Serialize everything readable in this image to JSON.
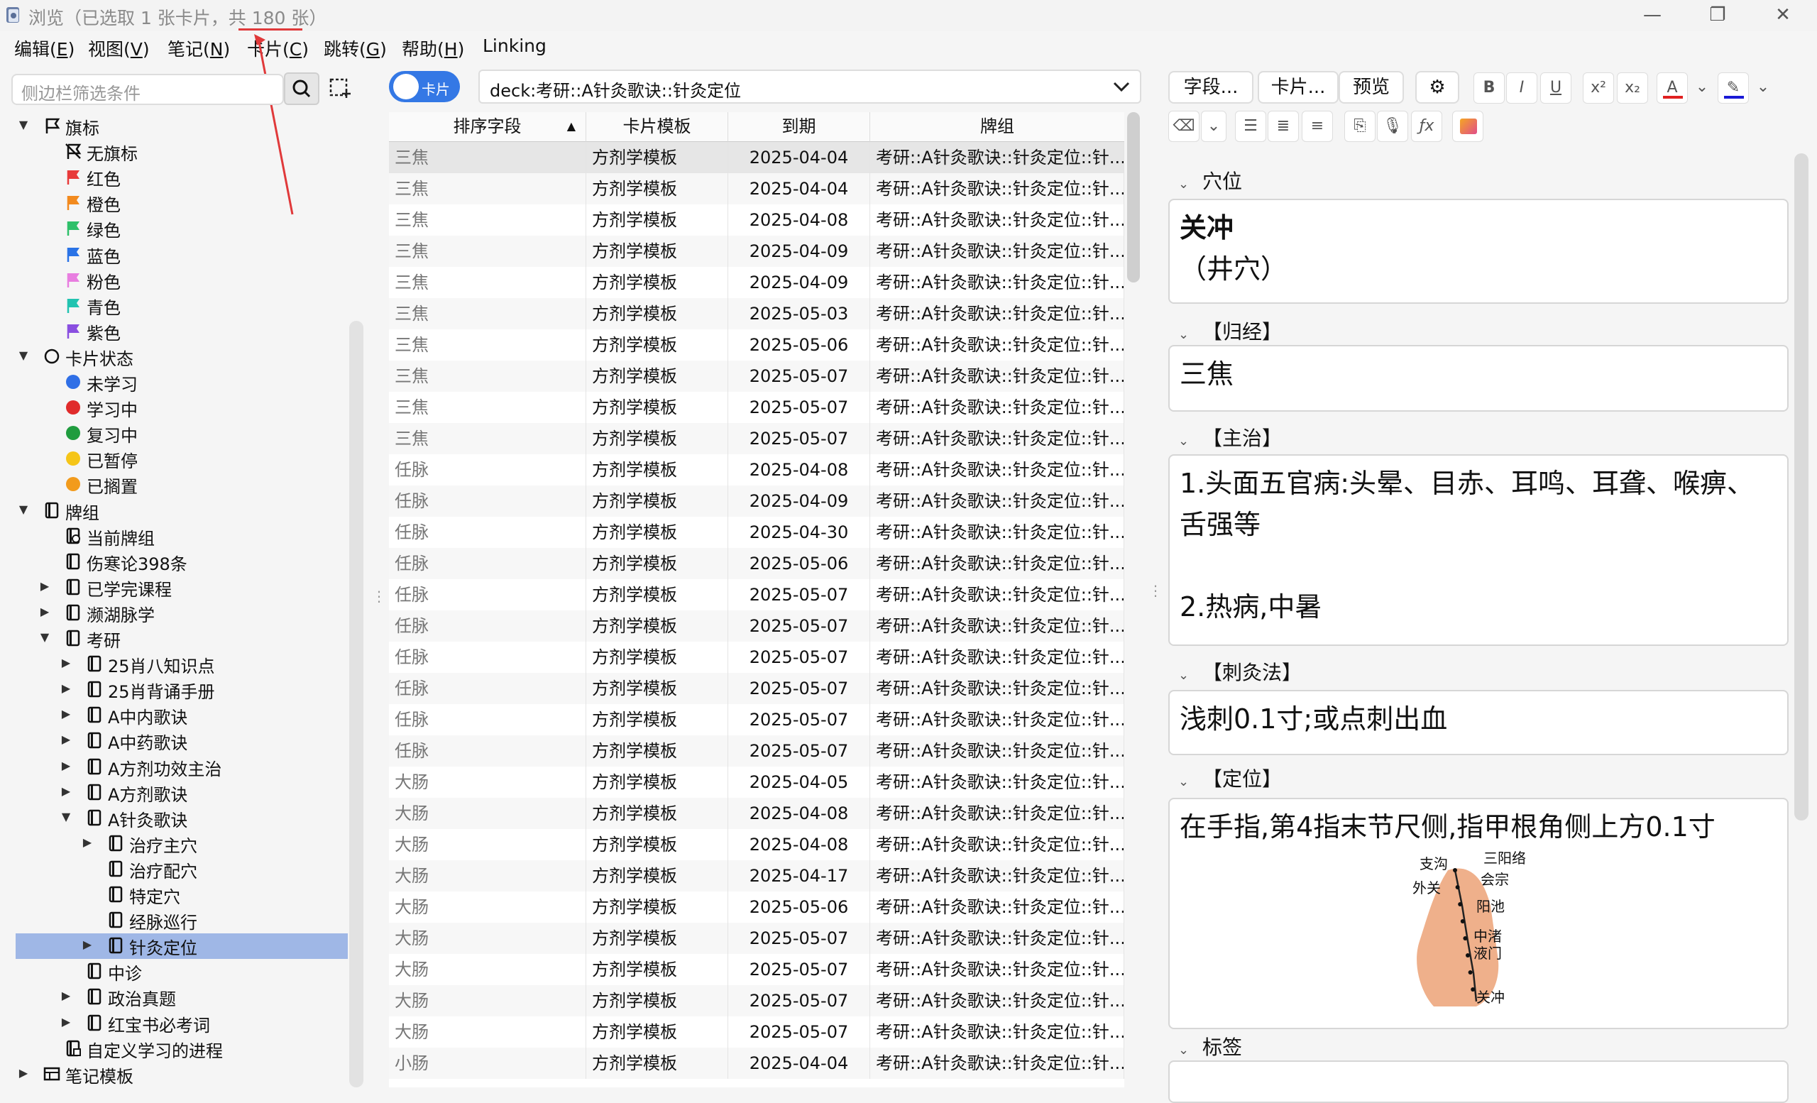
{
  "window": {
    "title": "浏览（已选取 1 张卡片，共 180 张）",
    "minimize_icon": "minimize-icon",
    "maximize_icon": "restore-icon",
    "close_icon": "close-icon"
  },
  "menu": [
    {
      "label": "编辑(",
      "key": "E",
      "end": ")"
    },
    {
      "label": "视图(",
      "key": "V",
      "end": ")"
    },
    {
      "label": "笔记(",
      "key": "N",
      "end": ")"
    },
    {
      "label": "卡片(",
      "key": "C",
      "end": ")"
    },
    {
      "label": "跳转(",
      "key": "G",
      "end": ")"
    },
    {
      "label": "帮助(",
      "key": "H",
      "end": ")"
    },
    {
      "label": "Linking",
      "key": "",
      "end": ""
    }
  ],
  "sidebar": {
    "search_placeholder": "侧边栏筛选条件",
    "tree": [
      {
        "label": "旗标",
        "depth": 0,
        "arrow": "down",
        "icon": "flag-outline"
      },
      {
        "label": "无旗标",
        "depth": 1,
        "arrow": "",
        "icon": "no-flag"
      },
      {
        "label": "红色",
        "depth": 1,
        "arrow": "",
        "icon": "flag",
        "color": "#e83a3a"
      },
      {
        "label": "橙色",
        "depth": 1,
        "arrow": "",
        "icon": "flag",
        "color": "#f28a1e"
      },
      {
        "label": "绿色",
        "depth": 1,
        "arrow": "",
        "icon": "flag",
        "color": "#2ec06a"
      },
      {
        "label": "蓝色",
        "depth": 1,
        "arrow": "",
        "icon": "flag",
        "color": "#2a73e6"
      },
      {
        "label": "粉色",
        "depth": 1,
        "arrow": "",
        "icon": "flag",
        "color": "#e87ee0"
      },
      {
        "label": "青色",
        "depth": 1,
        "arrow": "",
        "icon": "flag",
        "color": "#22c3b0"
      },
      {
        "label": "紫色",
        "depth": 1,
        "arrow": "",
        "icon": "flag",
        "color": "#8a4fe0"
      },
      {
        "label": "卡片状态",
        "depth": 0,
        "arrow": "down",
        "icon": "circle-outline"
      },
      {
        "label": "未学习",
        "depth": 1,
        "arrow": "",
        "icon": "dot",
        "color": "#2f6fe6"
      },
      {
        "label": "学习中",
        "depth": 1,
        "arrow": "",
        "icon": "dot",
        "color": "#e02b2b"
      },
      {
        "label": "复习中",
        "depth": 1,
        "arrow": "",
        "icon": "dot",
        "color": "#1f9c3e"
      },
      {
        "label": "已暂停",
        "depth": 1,
        "arrow": "",
        "icon": "dot",
        "color": "#f5c518"
      },
      {
        "label": "已搁置",
        "depth": 1,
        "arrow": "",
        "icon": "dot",
        "color": "#f29b1c"
      },
      {
        "label": "牌组",
        "depth": 0,
        "arrow": "down",
        "icon": "deck"
      },
      {
        "label": "当前牌组",
        "depth": 1,
        "arrow": "",
        "icon": "deck-current"
      },
      {
        "label": "伤寒论398条",
        "depth": 1,
        "arrow": "",
        "icon": "deck"
      },
      {
        "label": "已学完课程",
        "depth": 1,
        "arrow": "right",
        "icon": "deck"
      },
      {
        "label": "濒湖脉学",
        "depth": 1,
        "arrow": "right",
        "icon": "deck"
      },
      {
        "label": "考研",
        "depth": 1,
        "arrow": "down",
        "icon": "deck"
      },
      {
        "label": "25肖八知识点",
        "depth": 2,
        "arrow": "right",
        "icon": "deck"
      },
      {
        "label": "25肖背诵手册",
        "depth": 2,
        "arrow": "right",
        "icon": "deck"
      },
      {
        "label": "A中内歌诀",
        "depth": 2,
        "arrow": "right",
        "icon": "deck"
      },
      {
        "label": "A中药歌诀",
        "depth": 2,
        "arrow": "right",
        "icon": "deck"
      },
      {
        "label": "A方剂功效主治",
        "depth": 2,
        "arrow": "right",
        "icon": "deck"
      },
      {
        "label": "A方剂歌诀",
        "depth": 2,
        "arrow": "right",
        "icon": "deck"
      },
      {
        "label": "A针灸歌诀",
        "depth": 2,
        "arrow": "down",
        "icon": "deck"
      },
      {
        "label": "治疗主穴",
        "depth": 3,
        "arrow": "right",
        "icon": "deck"
      },
      {
        "label": "治疗配穴",
        "depth": 3,
        "arrow": "",
        "icon": "deck"
      },
      {
        "label": "特定穴",
        "depth": 3,
        "arrow": "",
        "icon": "deck"
      },
      {
        "label": "经脉巡行",
        "depth": 3,
        "arrow": "",
        "icon": "deck"
      },
      {
        "label": "针灸定位",
        "depth": 3,
        "arrow": "right",
        "icon": "deck",
        "selected": true
      },
      {
        "label": "中诊",
        "depth": 2,
        "arrow": "",
        "icon": "deck"
      },
      {
        "label": "政治真题",
        "depth": 2,
        "arrow": "right",
        "icon": "deck"
      },
      {
        "label": "红宝书必考词",
        "depth": 2,
        "arrow": "right",
        "icon": "deck"
      },
      {
        "label": "自定义学习的进程",
        "depth": 1,
        "arrow": "",
        "icon": "deck-custom"
      },
      {
        "label": "笔记模板",
        "depth": 0,
        "arrow": "right",
        "icon": "note-types"
      }
    ]
  },
  "browser": {
    "toggle_label": "卡片",
    "query": "deck:考研::A针灸歌诀::针灸定位",
    "columns": [
      "排序字段",
      "卡片模板",
      "到期",
      "牌组"
    ],
    "rows": [
      [
        "三焦",
        "方剂学模板",
        "2025-04-04",
        "考研::A针灸歌诀::针灸定位::针..."
      ],
      [
        "三焦",
        "方剂学模板",
        "2025-04-04",
        "考研::A针灸歌诀::针灸定位::针..."
      ],
      [
        "三焦",
        "方剂学模板",
        "2025-04-08",
        "考研::A针灸歌诀::针灸定位::针..."
      ],
      [
        "三焦",
        "方剂学模板",
        "2025-04-09",
        "考研::A针灸歌诀::针灸定位::针..."
      ],
      [
        "三焦",
        "方剂学模板",
        "2025-04-09",
        "考研::A针灸歌诀::针灸定位::针..."
      ],
      [
        "三焦",
        "方剂学模板",
        "2025-05-03",
        "考研::A针灸歌诀::针灸定位::针..."
      ],
      [
        "三焦",
        "方剂学模板",
        "2025-05-06",
        "考研::A针灸歌诀::针灸定位::针..."
      ],
      [
        "三焦",
        "方剂学模板",
        "2025-05-07",
        "考研::A针灸歌诀::针灸定位::针..."
      ],
      [
        "三焦",
        "方剂学模板",
        "2025-05-07",
        "考研::A针灸歌诀::针灸定位::针..."
      ],
      [
        "三焦",
        "方剂学模板",
        "2025-05-07",
        "考研::A针灸歌诀::针灸定位::针..."
      ],
      [
        "任脉",
        "方剂学模板",
        "2025-04-08",
        "考研::A针灸歌诀::针灸定位::针..."
      ],
      [
        "任脉",
        "方剂学模板",
        "2025-04-09",
        "考研::A针灸歌诀::针灸定位::针..."
      ],
      [
        "任脉",
        "方剂学模板",
        "2025-04-30",
        "考研::A针灸歌诀::针灸定位::针..."
      ],
      [
        "任脉",
        "方剂学模板",
        "2025-05-06",
        "考研::A针灸歌诀::针灸定位::针..."
      ],
      [
        "任脉",
        "方剂学模板",
        "2025-05-07",
        "考研::A针灸歌诀::针灸定位::针..."
      ],
      [
        "任脉",
        "方剂学模板",
        "2025-05-07",
        "考研::A针灸歌诀::针灸定位::针..."
      ],
      [
        "任脉",
        "方剂学模板",
        "2025-05-07",
        "考研::A针灸歌诀::针灸定位::针..."
      ],
      [
        "任脉",
        "方剂学模板",
        "2025-05-07",
        "考研::A针灸歌诀::针灸定位::针..."
      ],
      [
        "任脉",
        "方剂学模板",
        "2025-05-07",
        "考研::A针灸歌诀::针灸定位::针..."
      ],
      [
        "任脉",
        "方剂学模板",
        "2025-05-07",
        "考研::A针灸歌诀::针灸定位::针..."
      ],
      [
        "大肠",
        "方剂学模板",
        "2025-04-05",
        "考研::A针灸歌诀::针灸定位::针..."
      ],
      [
        "大肠",
        "方剂学模板",
        "2025-04-08",
        "考研::A针灸歌诀::针灸定位::针..."
      ],
      [
        "大肠",
        "方剂学模板",
        "2025-04-08",
        "考研::A针灸歌诀::针灸定位::针..."
      ],
      [
        "大肠",
        "方剂学模板",
        "2025-04-17",
        "考研::A针灸歌诀::针灸定位::针..."
      ],
      [
        "大肠",
        "方剂学模板",
        "2025-05-06",
        "考研::A针灸歌诀::针灸定位::针..."
      ],
      [
        "大肠",
        "方剂学模板",
        "2025-05-07",
        "考研::A针灸歌诀::针灸定位::针..."
      ],
      [
        "大肠",
        "方剂学模板",
        "2025-05-07",
        "考研::A针灸歌诀::针灸定位::针..."
      ],
      [
        "大肠",
        "方剂学模板",
        "2025-05-07",
        "考研::A针灸歌诀::针灸定位::针..."
      ],
      [
        "大肠",
        "方剂学模板",
        "2025-05-07",
        "考研::A针灸歌诀::针灸定位::针..."
      ],
      [
        "小肠",
        "方剂学模板",
        "2025-04-04",
        "考研::A针灸歌诀::针灸定位::针..."
      ]
    ]
  },
  "editor": {
    "buttons": {
      "fields": "字段...",
      "cards": "卡片...",
      "preview": "预览"
    },
    "format_icons": [
      "bold-icon",
      "italic-icon",
      "underline-icon",
      "superscript-icon",
      "subscript-icon",
      "text-color-icon",
      "highlight-icon",
      "eraser-icon",
      "bullet-list-icon",
      "numbered-list-icon",
      "align-icon",
      "attach-icon",
      "record-icon",
      "math-icon",
      "image-occlusion-icon"
    ],
    "format_glyphs": {
      "bold": "B",
      "italic": "I",
      "underline": "U",
      "sup": "x²",
      "sub": "x₂",
      "color": "A",
      "math": "ƒx"
    },
    "text_color": "#e02020",
    "highlight_color": "#1a1ad6",
    "fields": [
      {
        "label": "穴位",
        "lines": [
          "关冲",
          "（井穴）"
        ]
      },
      {
        "label": "【归经】",
        "lines": [
          "三焦"
        ]
      },
      {
        "label": "【主治】",
        "lines": [
          "1.头面五官病:头晕、目赤、耳鸣、耳聋、喉痹、",
          "舌强等",
          "",
          "2.热病,中暑"
        ]
      },
      {
        "label": "【刺灸法】",
        "lines": [
          "浅刺0.1寸;或点刺出血"
        ]
      },
      {
        "label": "【定位】",
        "lines": [
          "在手指,第4指末节尺侧,指甲根角侧上方0.1寸"
        ]
      },
      {
        "label": "标签",
        "lines": []
      }
    ],
    "image_labels": [
      "支沟",
      "三阳络",
      "外关",
      "会宗",
      "阳池",
      "中渚",
      "液门",
      "关冲"
    ]
  }
}
